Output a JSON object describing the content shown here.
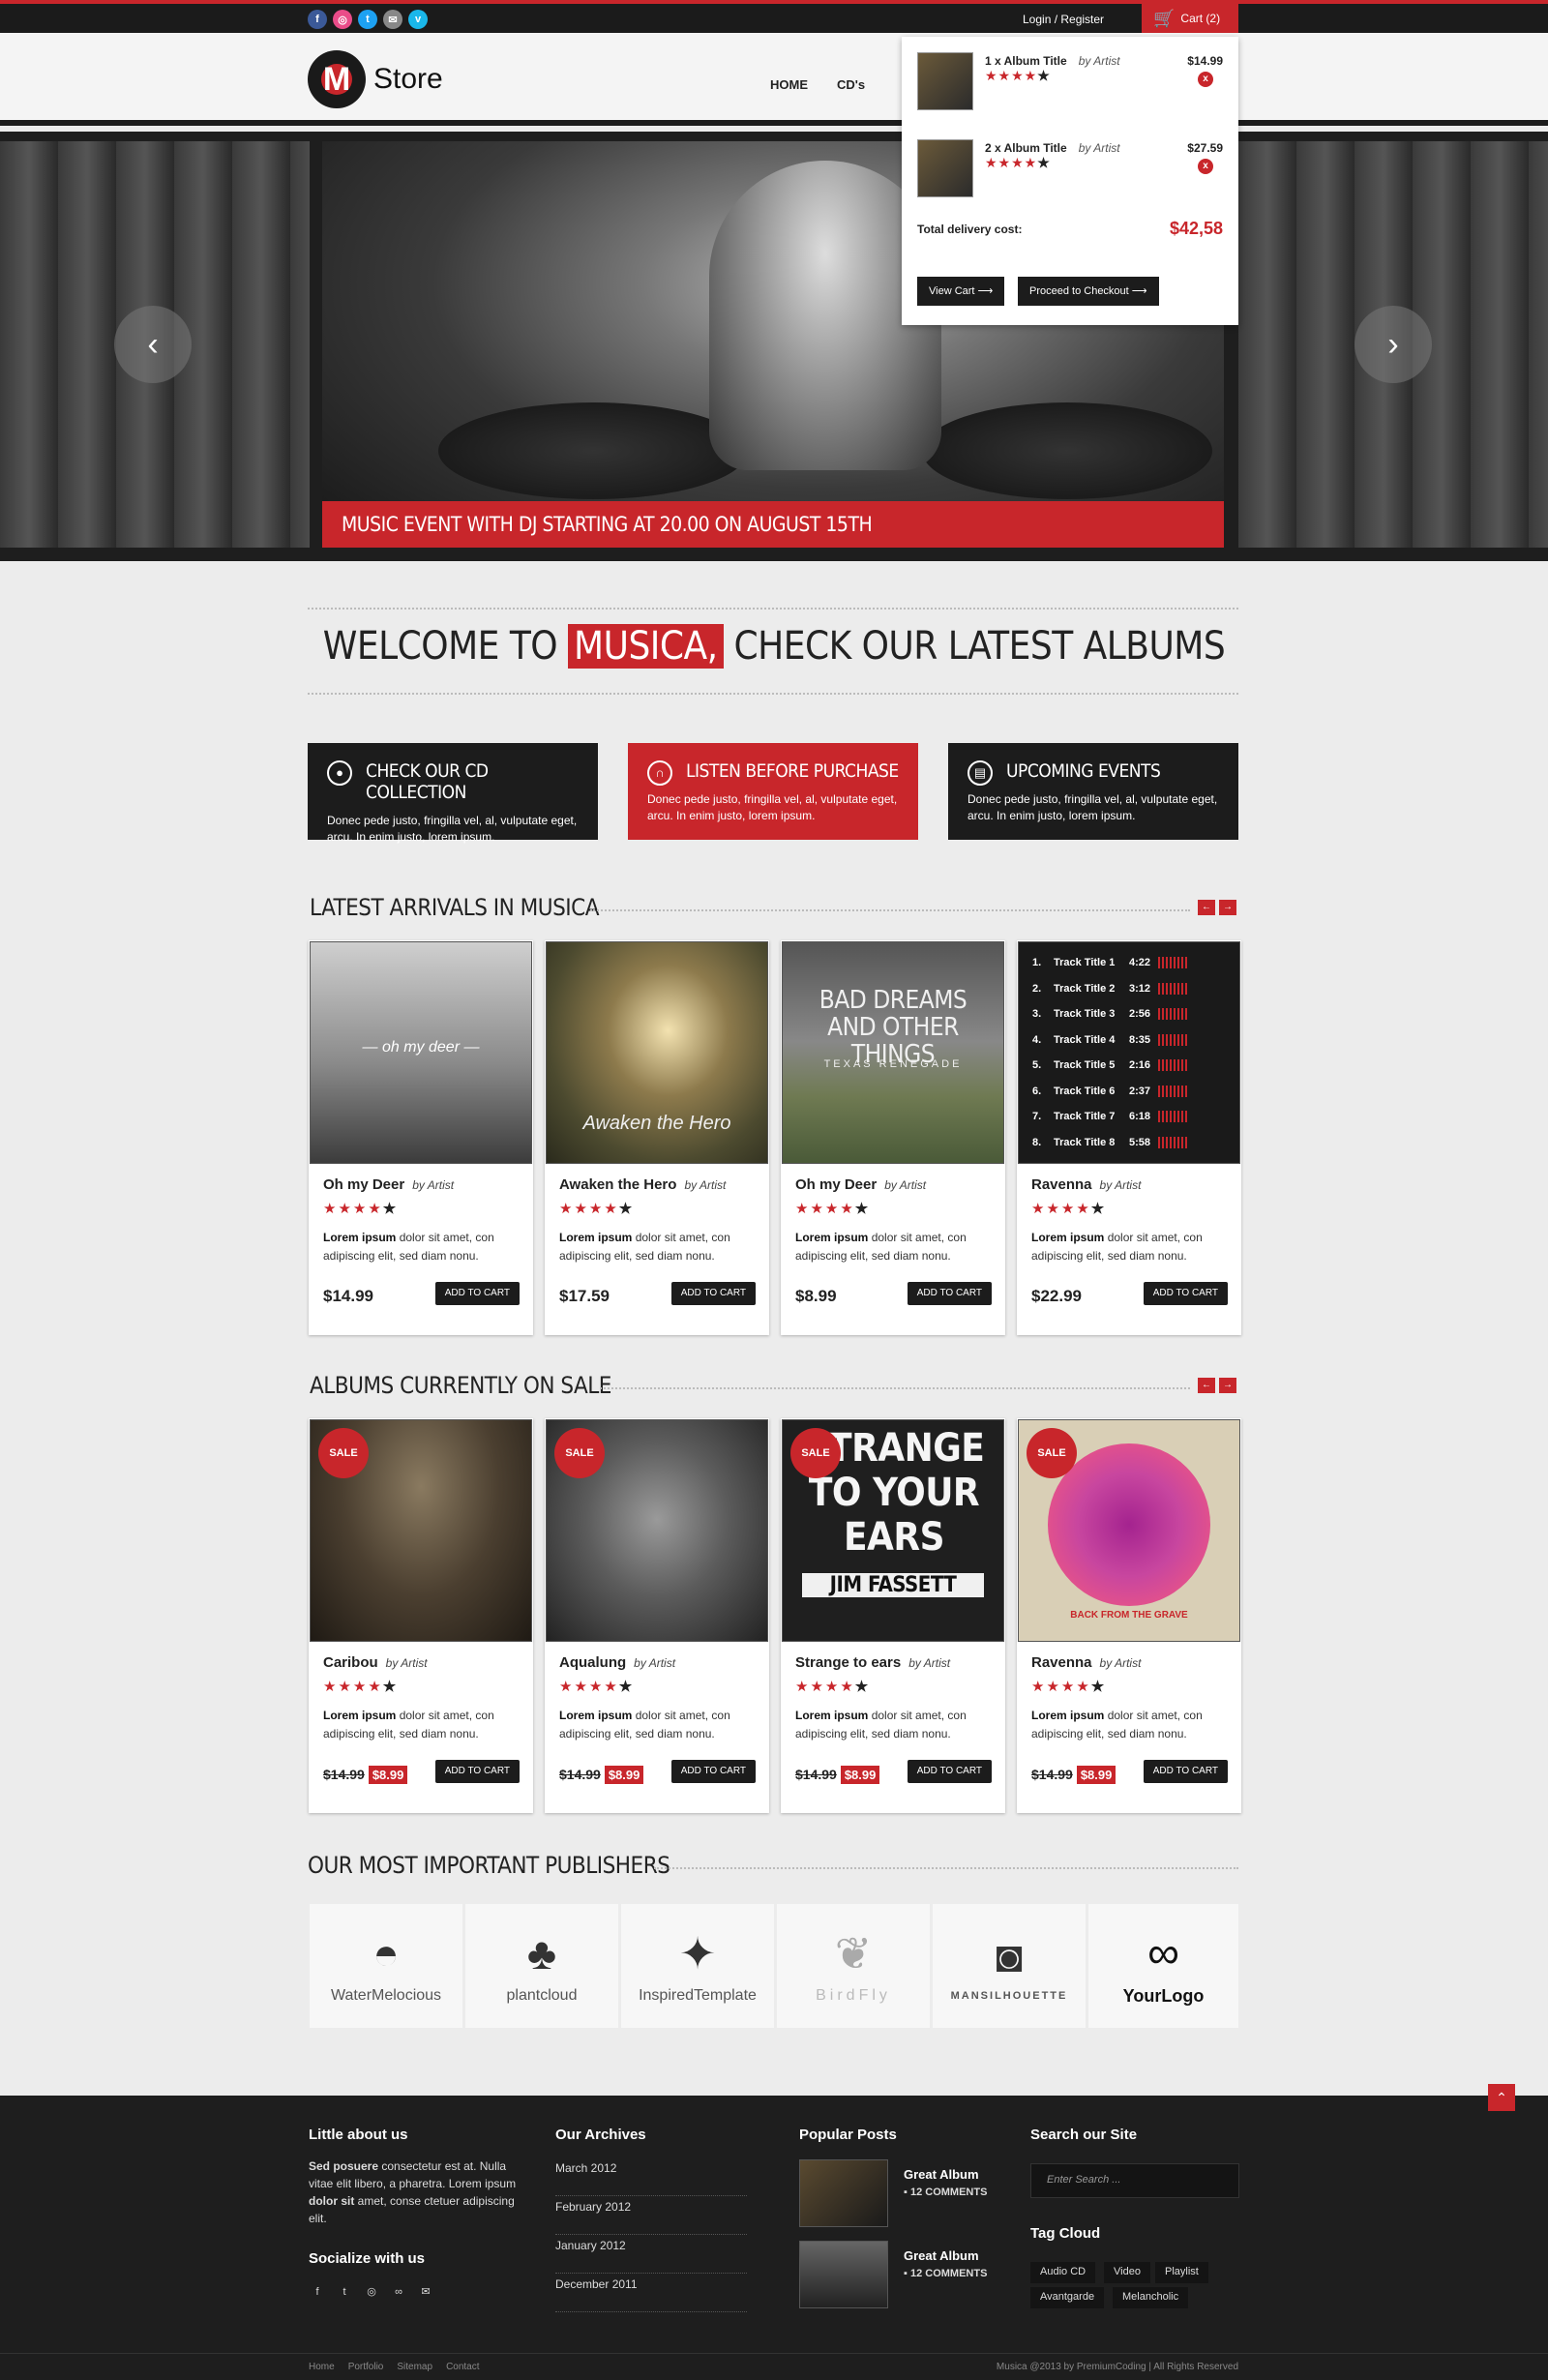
{
  "topbar": {
    "social": [
      {
        "icon": "facebook-icon",
        "glyph": "f",
        "color": "#3b5998"
      },
      {
        "icon": "dribbble-icon",
        "glyph": "◎",
        "color": "#ea4c89"
      },
      {
        "icon": "twitter-icon",
        "glyph": "t",
        "color": "#1da1f2"
      },
      {
        "icon": "email-icon",
        "glyph": "✉",
        "color": "#888888"
      },
      {
        "icon": "vimeo-icon",
        "glyph": "v",
        "color": "#1ab7ea"
      }
    ],
    "login": "Login / Register",
    "cart_label": "Cart (2)"
  },
  "header": {
    "logo_letter": "M",
    "logo_name": "Store",
    "nav": [
      "HOME",
      "CD's"
    ]
  },
  "hero": {
    "caption": "MUSIC EVENT WITH DJ STARTING AT 20.00 ON AUGUST 15TH",
    "prev": "‹",
    "next": "›"
  },
  "cart": {
    "items": [
      {
        "qty_title": "1 x Album Title",
        "by": "by Artist",
        "price": "$14.99",
        "stars": "★★★★",
        "empty_star": "★",
        "remove": "x"
      },
      {
        "qty_title": "2 x Album Title",
        "by": "by Artist",
        "price": "$27.59",
        "stars": "★★★★",
        "empty_star": "★",
        "remove": "x"
      }
    ],
    "total_label": "Total delivery cost:",
    "total_value": "$42,58",
    "view_cart": "View Cart  ⟶",
    "checkout": "Proceed to Checkout  ⟶"
  },
  "welcome": {
    "before": "WELCOME TO ",
    "highlight": "MUSICA,",
    "after": " CHECK OUR LATEST ALBUMS"
  },
  "features": [
    {
      "title": "CHECK OUR CD COLLECTION",
      "text": "Donec pede justo, fringilla vel, al, vulputate eget, arcu. In enim justo, lorem ipsum.",
      "icon": "disc-icon",
      "glyph": "●"
    },
    {
      "title": "LISTEN BEFORE PURCHASE",
      "text": "Donec pede justo, fringilla vel, al, vulputate eget, arcu. In enim justo, lorem ipsum.",
      "icon": "headphones-icon",
      "glyph": "∩"
    },
    {
      "title": "UPCOMING EVENTS",
      "text": "Donec pede justo, fringilla vel, al, vulputate eget, arcu. In enim justo, lorem ipsum.",
      "icon": "ticket-icon",
      "glyph": "▤"
    }
  ],
  "latest": {
    "heading": "LATEST ARRIVALS IN MUSICA",
    "prev": "←",
    "next": "→",
    "items": [
      {
        "title": "Oh my Deer",
        "by": "by Artist",
        "desc_bold": "Lorem ipsum",
        "desc": " dolor sit amet, con adipiscing elit, sed diam nonu.",
        "price": "$14.99",
        "btn": "ADD TO CART",
        "art_text": "— oh my deer —"
      },
      {
        "title": "Awaken the Hero",
        "by": "by Artist",
        "desc_bold": "Lorem ipsum",
        "desc": " dolor sit amet, con adipiscing elit, sed diam nonu.",
        "price": "$17.59",
        "btn": "ADD TO CART",
        "art_text": "Awaken the Hero"
      },
      {
        "title": "Oh my Deer",
        "by": "by Artist",
        "desc_bold": "Lorem ipsum",
        "desc": " dolor sit amet, con adipiscing elit, sed diam nonu.",
        "price": "$8.99",
        "btn": "ADD TO CART",
        "art_text": "BAD DREAMS AND OTHER THINGS",
        "art_sub": "TEXAS RENEGADE"
      },
      {
        "title": "Ravenna",
        "by": "by Artist",
        "desc_bold": "Lorem ipsum",
        "desc": " dolor sit amet, con adipiscing elit, sed diam nonu.",
        "price": "$22.99",
        "btn": "ADD TO CART"
      }
    ],
    "tracks": [
      {
        "n": "1.",
        "t": "Track Title 1",
        "d": "4:22"
      },
      {
        "n": "2.",
        "t": "Track Title 2",
        "d": "3:12"
      },
      {
        "n": "3.",
        "t": "Track Title 3",
        "d": "2:56"
      },
      {
        "n": "4.",
        "t": "Track Title 4",
        "d": "8:35"
      },
      {
        "n": "5.",
        "t": "Track Title 5",
        "d": "2:16"
      },
      {
        "n": "6.",
        "t": "Track Title 6",
        "d": "2:37"
      },
      {
        "n": "7.",
        "t": "Track Title 7",
        "d": "6:18"
      },
      {
        "n": "8.",
        "t": "Track Title 8",
        "d": "5:58"
      }
    ]
  },
  "sale": {
    "heading": "ALBUMS CURRENTLY ON SALE",
    "prev": "←",
    "next": "→",
    "badge": "SALE",
    "items": [
      {
        "title": "Caribou",
        "by": "by Artist",
        "desc_bold": "Lorem ipsum",
        "desc": " dolor sit amet, con adipiscing elit, sed diam nonu.",
        "old": "$14.99",
        "new": "$8.99",
        "btn": "ADD TO CART"
      },
      {
        "title": "Aqualung",
        "by": "by Artist",
        "desc_bold": "Lorem ipsum",
        "desc": " dolor sit amet, con adipiscing elit, sed diam nonu.",
        "old": "$14.99",
        "new": "$8.99",
        "btn": "ADD TO CART"
      },
      {
        "title": "Strange to ears",
        "by": "by Artist",
        "desc_bold": "Lorem ipsum",
        "desc": " dolor sit amet, con adipiscing elit, sed diam nonu.",
        "old": "$14.99",
        "new": "$8.99",
        "btn": "ADD TO CART",
        "art_text": "STRANGE TO YOUR EARS",
        "art_sub": "JIM FASSETT"
      },
      {
        "title": "Ravenna",
        "by": "by Artist",
        "desc_bold": "Lorem ipsum",
        "desc": " dolor sit amet, con adipiscing elit, sed diam nonu.",
        "old": "$14.99",
        "new": "$8.99",
        "btn": "ADD TO CART",
        "art_text": "BACK FROM THE GRAVE"
      }
    ]
  },
  "publishers": {
    "heading": "OUR MOST IMPORTANT PUBLISHERS",
    "items": [
      {
        "name": "WaterMelocious",
        "icon": "watermelon-icon",
        "glyph": "◓"
      },
      {
        "name": "plantcloud",
        "icon": "tree-icon",
        "glyph": "♣"
      },
      {
        "name": "InspiredTemplate",
        "icon": "stars-icon",
        "glyph": "✦"
      },
      {
        "name": "BirdFly",
        "icon": "bird-icon",
        "glyph": "❦"
      },
      {
        "name": "MANSILHOUETTE",
        "icon": "hat-icon",
        "glyph": "◙"
      },
      {
        "name": "YourLogo",
        "icon": "loop-icon",
        "glyph": "∞"
      }
    ]
  },
  "footer": {
    "about_heading": "Little about us",
    "about_b1": "Sed posuere",
    "about_t1": " consectetur  est at. Nulla vitae elit libero, a pharetra. Lorem ipsum ",
    "about_b2": "dolor sit",
    "about_t2": " amet, conse ctetuer adipiscing elit.",
    "social_heading": "Socialize with us",
    "social": [
      {
        "icon": "facebook-icon",
        "glyph": "f"
      },
      {
        "icon": "twitter-icon",
        "glyph": "t"
      },
      {
        "icon": "dribbble-icon",
        "glyph": "◎"
      },
      {
        "icon": "flickr-icon",
        "glyph": "∞"
      },
      {
        "icon": "email-icon",
        "glyph": "✉"
      }
    ],
    "archives_heading": "Our Archives",
    "archives": [
      "March 2012",
      "February 2012",
      "January 2012",
      "December 2011"
    ],
    "posts_heading": "Popular Posts",
    "posts": [
      {
        "title": "Great Album",
        "comments": "12 COMMENTS"
      },
      {
        "title": "Great Album",
        "comments": "12 COMMENTS"
      }
    ],
    "search_heading": "Search our Site",
    "search_placeholder": "Enter Search ...",
    "tags_heading": "Tag Cloud",
    "tags": [
      "Audio CD",
      "Video",
      "Playlist",
      "Avantgarde",
      "Melancholic"
    ],
    "bottom_links": [
      "Home",
      "Portfolio",
      "Sitemap",
      "Contact"
    ],
    "copyright": "Musica @2013 by PremiumCoding | All Rights Reserved",
    "to_top": "⌃"
  }
}
